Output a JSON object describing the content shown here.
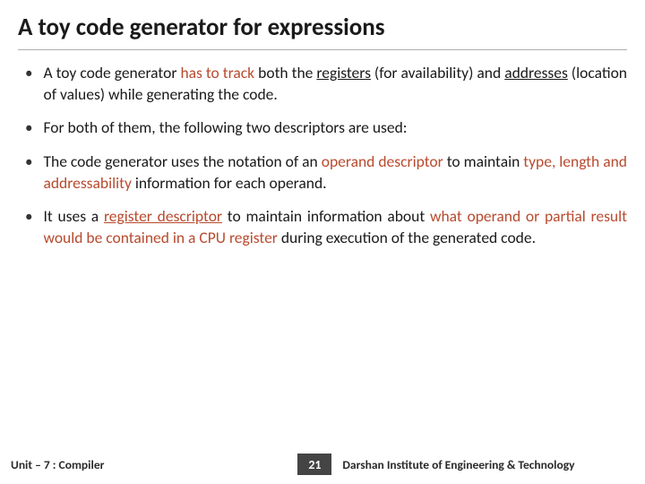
{
  "title": "A toy code generator for expressions",
  "bullets": [
    {
      "pre": "A toy code generator ",
      "hl1": "has to track",
      "mid1": " both the ",
      "ul1": "registers",
      "mid2": " (for availability) and ",
      "ul2": "addresses",
      "post": " (location of values) while generating the code."
    },
    {
      "text": "For both of them, the following two descriptors are used:"
    },
    {
      "pre": "The code generator uses the notation of an ",
      "hl1": "operand descriptor",
      "mid1": " to maintain ",
      "hl2": "type, length and addressability",
      "post": " information for each operand."
    },
    {
      "pre": "It uses a ",
      "hlul": "register descriptor",
      "mid1": " to maintain information about ",
      "hl2": "what operand or partial result would be contained in a CPU register",
      "post": " during execution of the generated code."
    }
  ],
  "footer": {
    "left": "Unit – 7  : Compiler",
    "page": "21",
    "right": "Darshan Institute of Engineering & Technology"
  }
}
